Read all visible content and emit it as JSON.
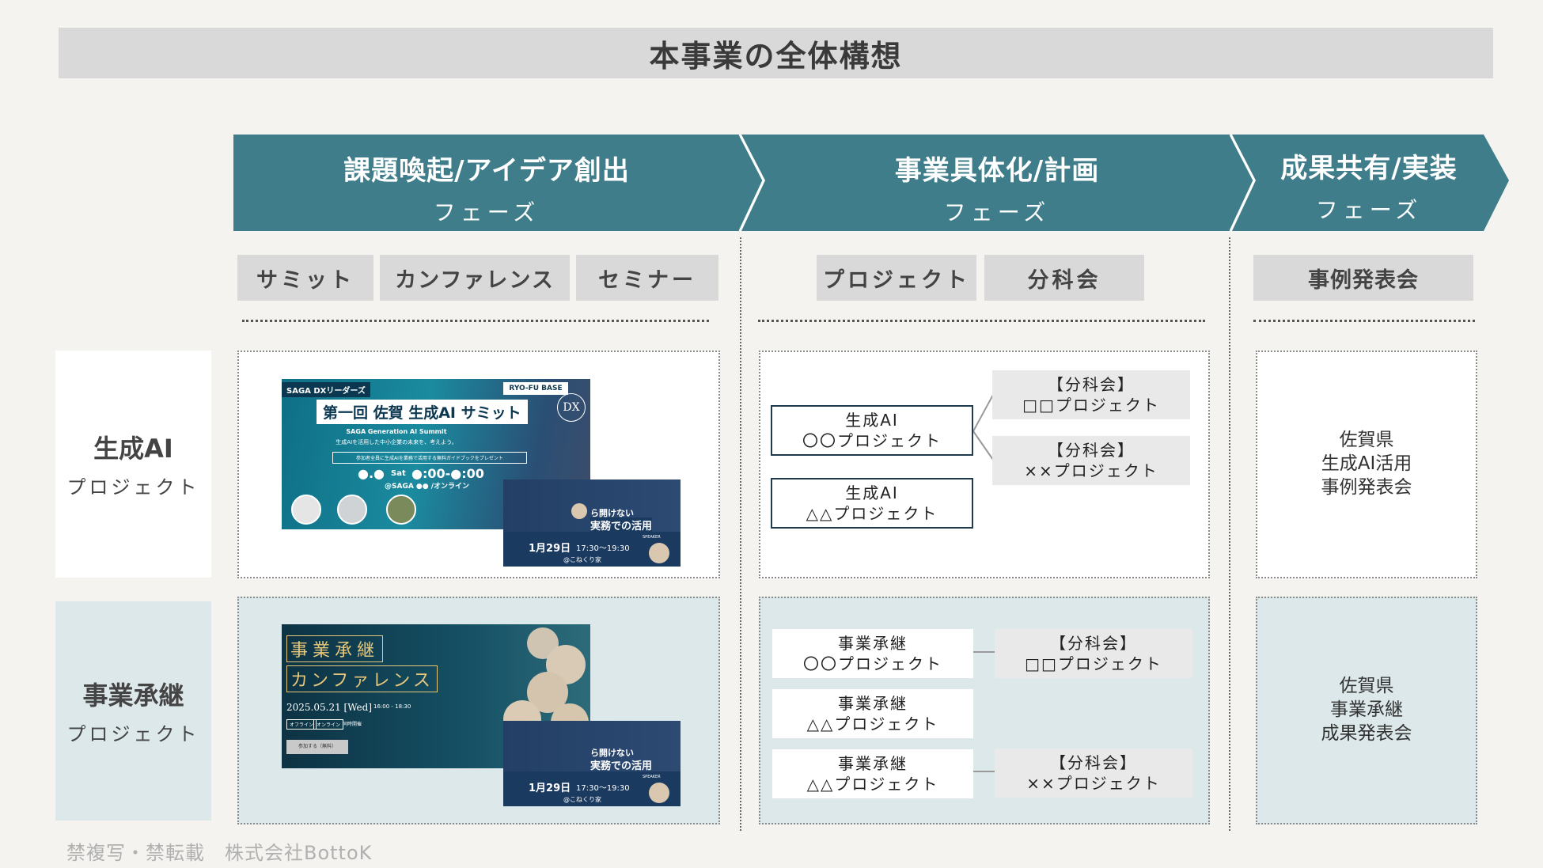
{
  "title": "本事業の全体構想",
  "phases": [
    {
      "name": "課題喚起/アイデア創出",
      "suffix": "フェーズ"
    },
    {
      "name": "事業具体化/計画",
      "suffix": "フェーズ"
    },
    {
      "name": "成果共有/実装",
      "suffix": "フェーズ"
    }
  ],
  "categories": {
    "phase1": [
      "サミット",
      "カンファレンス",
      "セミナー"
    ],
    "phase2": [
      "プロジェクト",
      "分科会"
    ],
    "phase3": [
      "事例発表会"
    ]
  },
  "rows": [
    {
      "title": "生成AI",
      "subtitle": "プロジェクト"
    },
    {
      "title": "事業承継",
      "subtitle": "プロジェクト"
    }
  ],
  "flyer_ai": {
    "badge": "SAGA DXリーダーズ",
    "logo": "RYO-FU BASE",
    "dx": "DX",
    "headline": "第一回 佐賀 生成AI サミット",
    "sub_en": "SAGA Generation AI Summit",
    "tagline": "生成AIを活用した中小企業の未来を、考えよう。",
    "banner": "参加者全員に生成AIを業務で活用する無料ガイドブックをプレゼント",
    "date": "●.●",
    "day": "Sat",
    "time": "●:00-●:00",
    "venue": "@SAGA ●● /オンライン"
  },
  "flyer_seminar": {
    "line1": "ら開けない",
    "line2": "実務での活用",
    "date": "1月29日",
    "time": "17:30〜19:30",
    "venue": "@こねくり家",
    "speaker": "SPEAKER"
  },
  "flyer_biz": {
    "heading1": "事業承継",
    "heading2": "カンファレンス",
    "date": "2025.05.21 [Wed]",
    "time": "16:00 - 18:30",
    "tags": [
      "オフライン",
      "オンライン",
      "同時開催"
    ],
    "button": "参加する（無料）"
  },
  "ai_projects": [
    {
      "line1": "生成AI",
      "line2": "〇〇プロジェクト"
    },
    {
      "line1": "生成AI",
      "line2": "△△プロジェクト"
    }
  ],
  "ai_subcommittees": [
    {
      "line1": "【分科会】",
      "line2": "□□プロジェクト"
    },
    {
      "line1": "【分科会】",
      "line2": "××プロジェクト"
    }
  ],
  "biz_projects": [
    {
      "line1": "事業承継",
      "line2": "〇〇プロジェクト"
    },
    {
      "line1": "事業承継",
      "line2": "△△プロジェクト"
    },
    {
      "line1": "事業承継",
      "line2": "△△プロジェクト"
    }
  ],
  "biz_subcommittees": [
    {
      "line1": "【分科会】",
      "line2": "□□プロジェクト"
    },
    {
      "line1": "【分科会】",
      "line2": "××プロジェクト"
    }
  ],
  "cases": [
    {
      "l1": "佐賀県",
      "l2": "生成AI活用",
      "l3": "事例発表会"
    },
    {
      "l1": "佐賀県",
      "l2": "事業承継",
      "l3": "成果発表会"
    }
  ],
  "footer": "禁複写・禁転載　株式会社BottoK",
  "colors": {
    "phase": "#3f7d8a",
    "row_blue": "#dce8ea",
    "pill": "#d9d9d9",
    "navy": "#1f3a4a"
  }
}
